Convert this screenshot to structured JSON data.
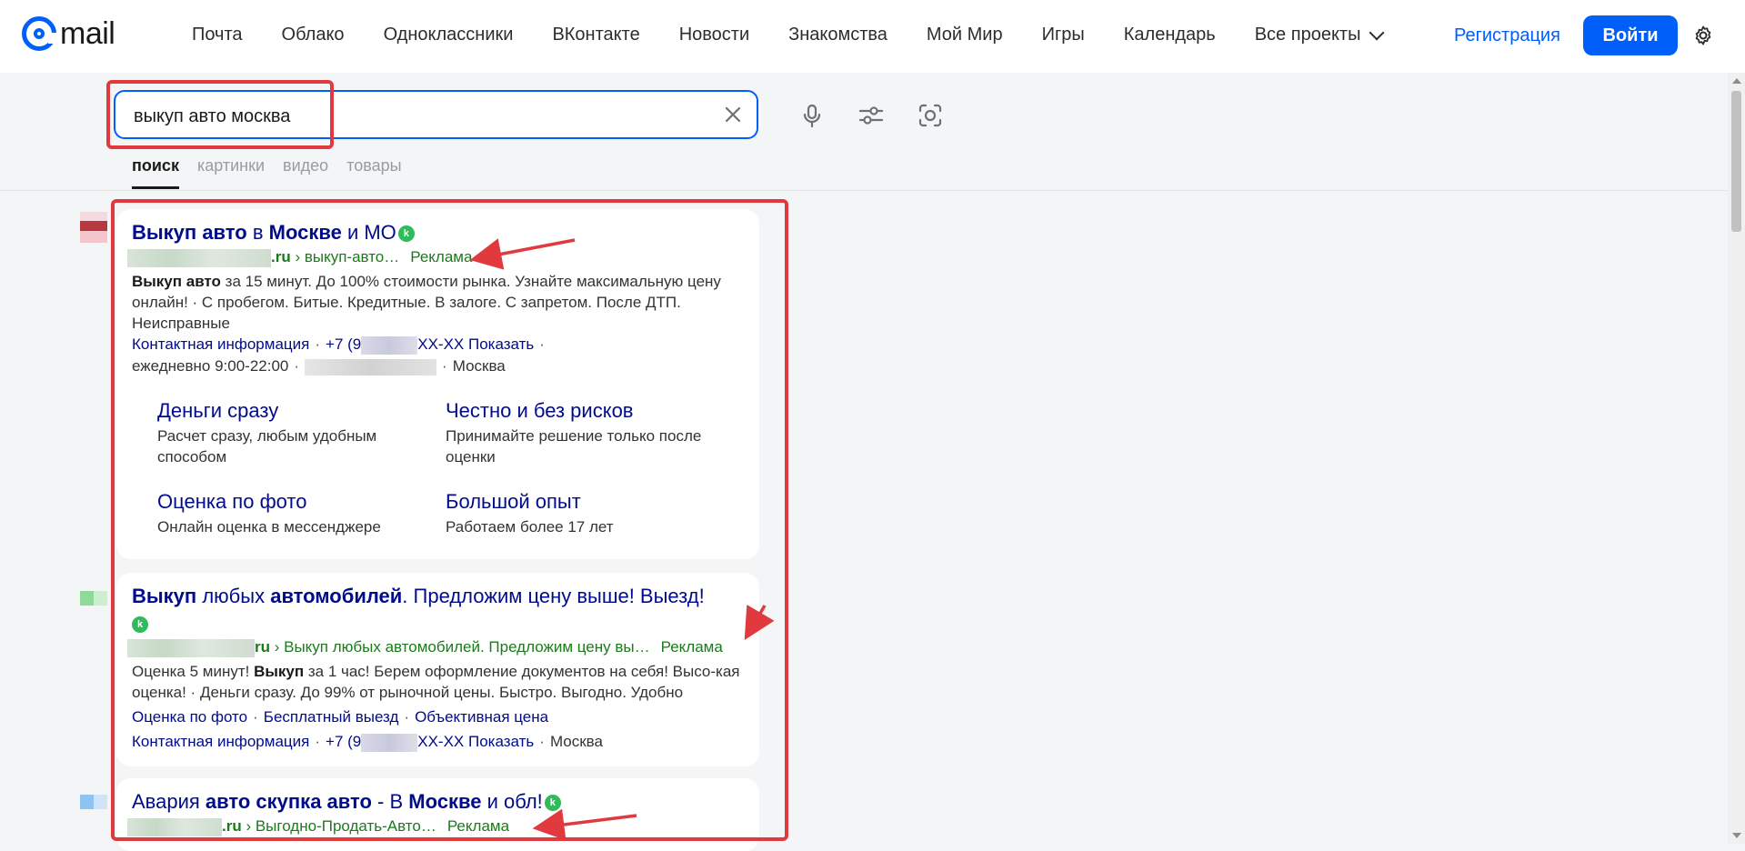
{
  "header": {
    "logo_text": "mail",
    "nav": [
      "Почта",
      "Облако",
      "Одноклассники",
      "ВКонтакте",
      "Новости",
      "Знакомства",
      "Мой Мир",
      "Игры",
      "Календарь"
    ],
    "all_projects": "Все проекты",
    "register": "Регистрация",
    "login": "Войти"
  },
  "search": {
    "query": "выкуп авто москва",
    "tabs": [
      "поиск",
      "картинки",
      "видео",
      "товары"
    ],
    "active_tab": "поиск"
  },
  "results": [
    {
      "title_parts": [
        {
          "t": "Выкуп авто",
          "b": true
        },
        {
          "t": " в ",
          "b": false
        },
        {
          "t": "Москве",
          "b": true
        },
        {
          "t": " и МО",
          "b": false
        }
      ],
      "badge": "k",
      "url_domain": ".ru",
      "url_path": " › выкуп-авто…",
      "ad_label": "Реклама",
      "text_parts": [
        {
          "t": "Выкуп авто",
          "b": true
        },
        {
          "t": " за 15 минут. До 100% стоимости рынка. Узнайте максимальную цену онлайн! · С пробегом. Битые. Кредитные. В залоге. С запретом. После ДТП. Неисправные",
          "b": false
        }
      ],
      "contact_label": "Контактная информация",
      "phone_prefix": "+7 (9",
      "phone_suffix": "XX-XX Показать",
      "hours": "ежедневно 9:00-22:00",
      "city": "Москва",
      "sitelinks": [
        {
          "title": "Деньги сразу",
          "desc": "Расчет сразу, любым удобным способом"
        },
        {
          "title": "Честно и без рисков",
          "desc": "Принимайте решение только после оценки"
        },
        {
          "title": "Оценка по фото",
          "desc": "Онлайн оценка в мессенджере"
        },
        {
          "title": "Большой опыт",
          "desc": "Работаем более 17 лет"
        }
      ]
    },
    {
      "title_parts": [
        {
          "t": "Выкуп",
          "b": true
        },
        {
          "t": " любых ",
          "b": false
        },
        {
          "t": "автомобилей",
          "b": true
        },
        {
          "t": ". Предложим цену выше! Выезд!",
          "b": false
        }
      ],
      "badge": "k",
      "url_domain": "ru",
      "url_path": " › Выкуп любых автомобилей. Предложим цену вы…",
      "ad_label": "Реклама",
      "text_parts": [
        {
          "t": "Оценка 5 минут! ",
          "b": false
        },
        {
          "t": "Выкуп",
          "b": true
        },
        {
          "t": " за 1 час! Берем оформление документов на себя! Высо-кая оценка! · Деньги сразу. До 99% от рыночной цены. Быстро. Выгодно. Удобно",
          "b": false
        }
      ],
      "quicklinks": [
        "Оценка по фото",
        "Бесплатный выезд",
        "Объективная цена"
      ],
      "contact_label": "Контактная информация",
      "phone_prefix": "+7 (9",
      "phone_suffix": "XX-XX Показать",
      "city": "Москва"
    },
    {
      "title_parts": [
        {
          "t": "Авария ",
          "b": false
        },
        {
          "t": "авто скупка авто",
          "b": true
        },
        {
          "t": " - В ",
          "b": false
        },
        {
          "t": "Москве",
          "b": true
        },
        {
          "t": " и обл!",
          "b": false
        }
      ],
      "badge": "k",
      "url_domain": ".ru",
      "url_path": " › Выгодно-Продать-Авто…",
      "ad_label": "Реклама"
    }
  ],
  "colors": {
    "accent": "#005ff9",
    "link": "#000c8a",
    "url_green": "#1b7b1b",
    "annotation_red": "#e0393e"
  },
  "icons": [
    "gear-icon",
    "microphone-icon",
    "filters-icon",
    "camera-search-icon",
    "clear-icon",
    "chevron-down-icon"
  ]
}
